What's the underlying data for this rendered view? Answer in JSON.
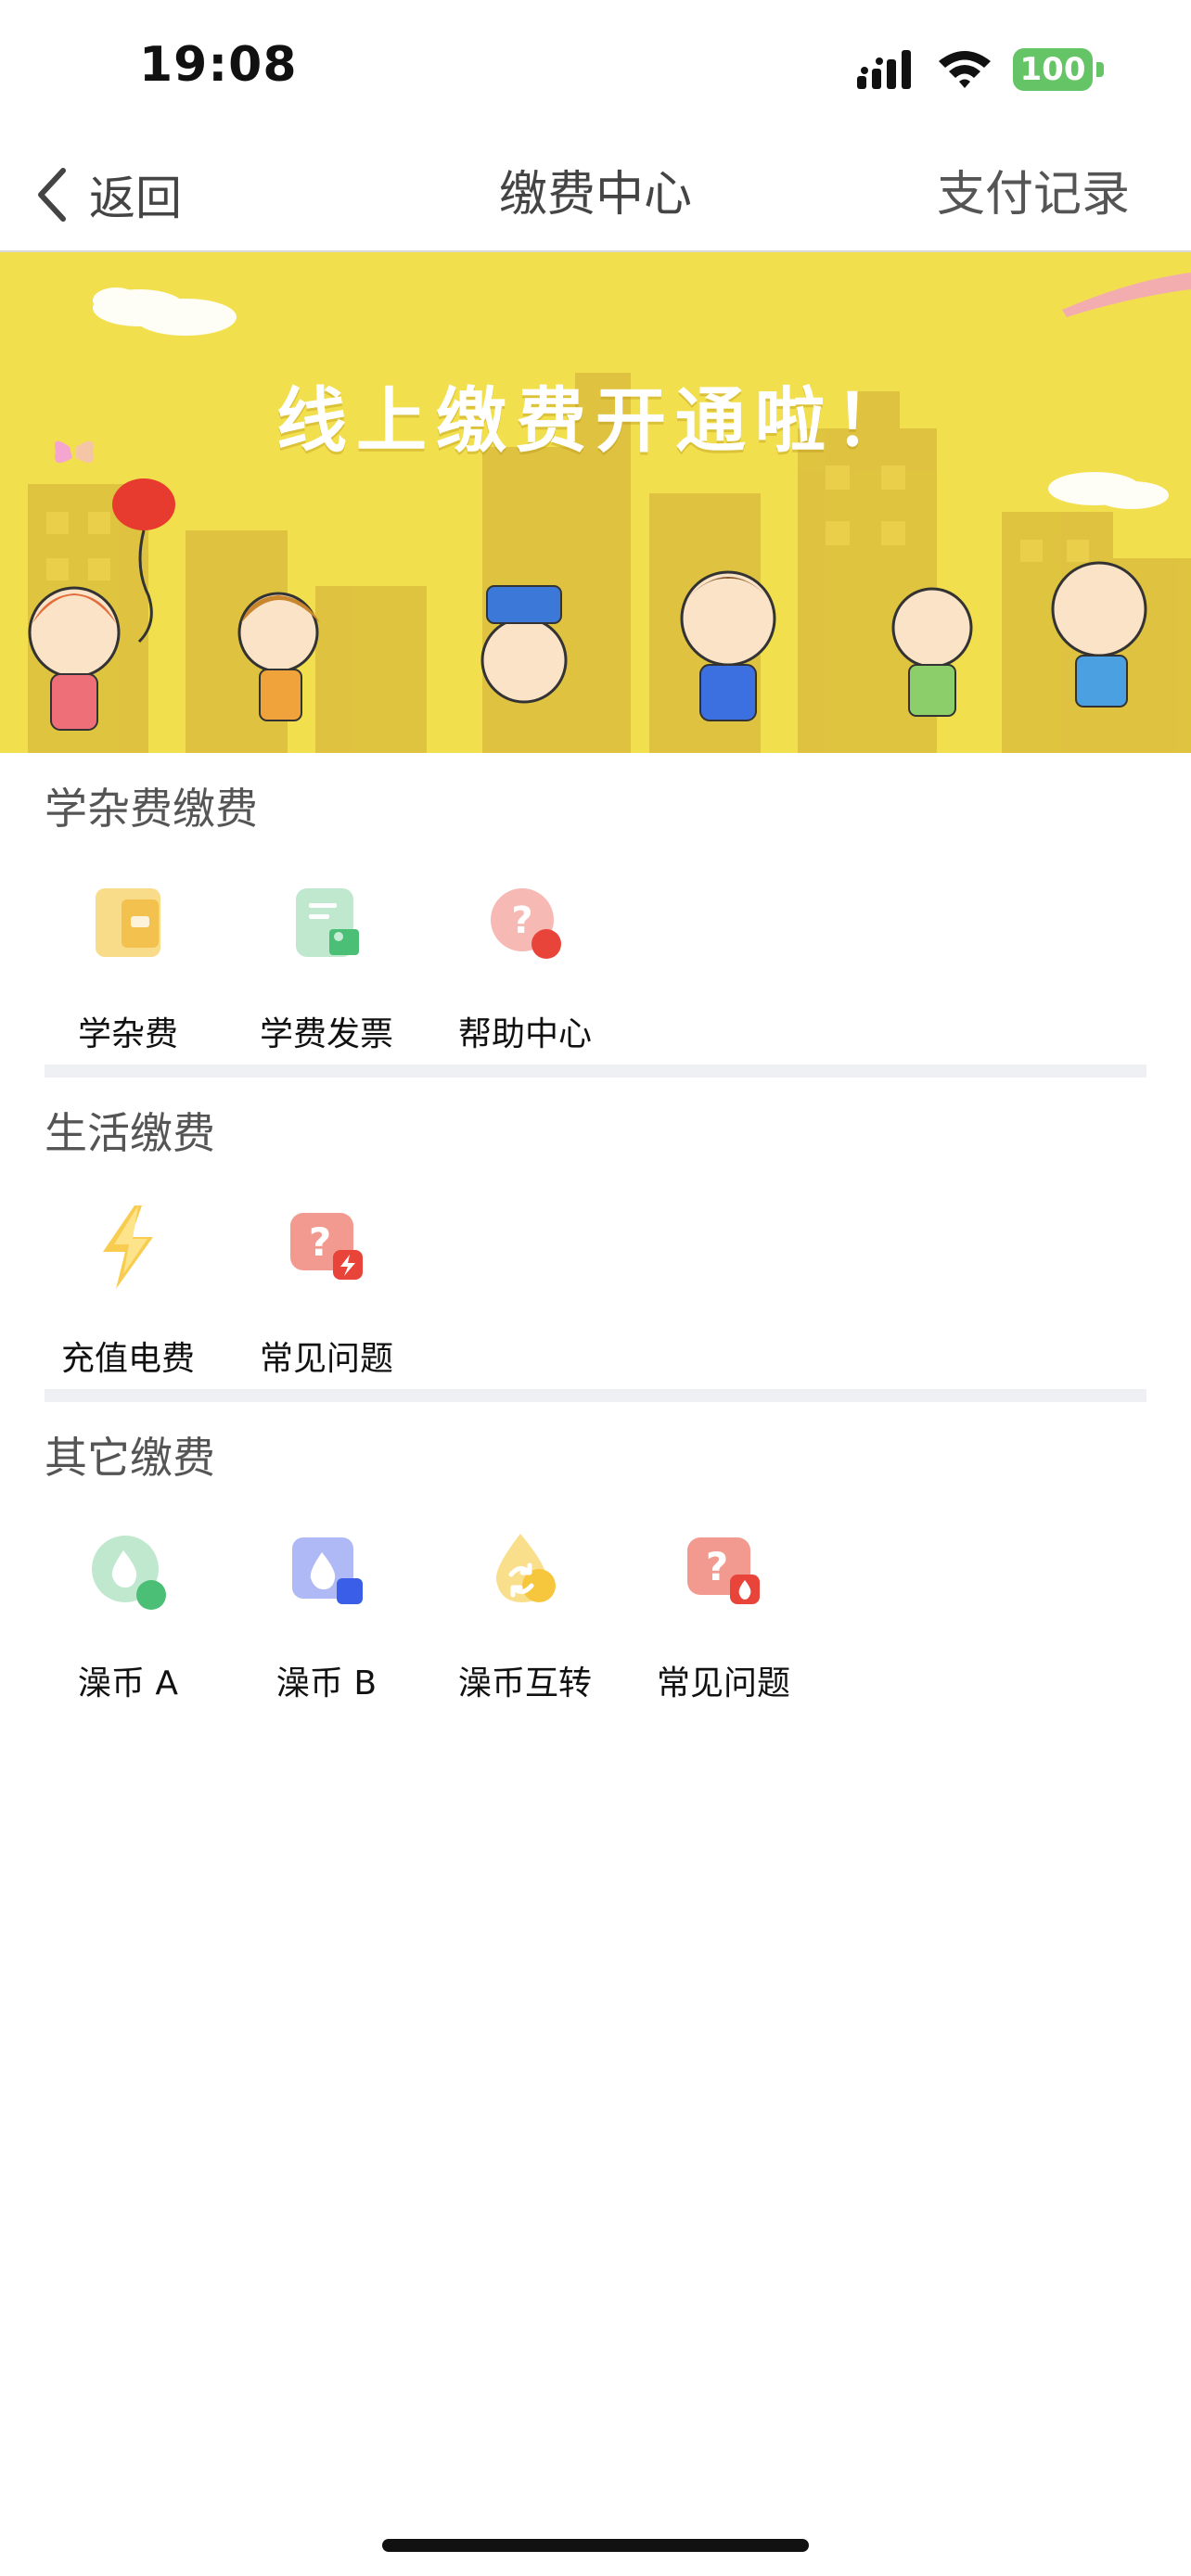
{
  "status": {
    "time": "19:08",
    "battery": "100"
  },
  "nav": {
    "back_label": "返回",
    "title": "缴费中心",
    "right_label": "支付记录"
  },
  "banner": {
    "text": "线上缴费开通啦！"
  },
  "sections": [
    {
      "title": "学杂费缴费",
      "items": [
        {
          "label": "学杂费",
          "icon": "wallet-icon"
        },
        {
          "label": "学费发票",
          "icon": "invoice-icon"
        },
        {
          "label": "帮助中心",
          "icon": "help-icon"
        }
      ]
    },
    {
      "title": "生活缴费",
      "items": [
        {
          "label": "充值电费",
          "icon": "lightning-icon"
        },
        {
          "label": "常见问题",
          "icon": "faq-icon"
        }
      ]
    },
    {
      "title": "其它缴费",
      "items": [
        {
          "label": "澡币 A",
          "icon": "water-drop-icon"
        },
        {
          "label": "澡币 B",
          "icon": "water-drop-blue-icon"
        },
        {
          "label": "澡币互转",
          "icon": "exchange-icon"
        },
        {
          "label": "常见问题",
          "icon": "faq-icon"
        }
      ]
    }
  ],
  "colors": {
    "banner_yellow": "#f2df4e",
    "battery_green": "#65c466",
    "divider": "#eff0f4"
  }
}
